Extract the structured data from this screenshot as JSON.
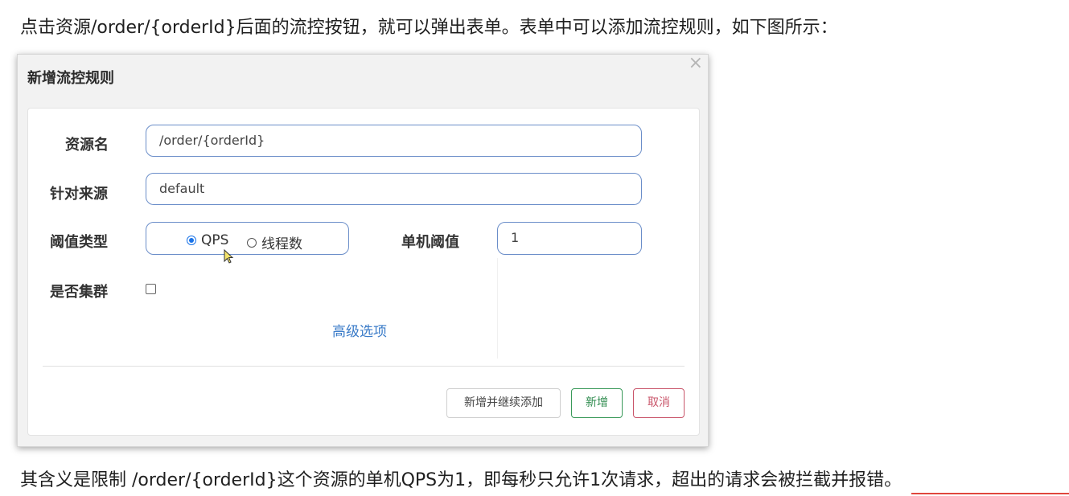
{
  "intro_text": "点击资源/order/{orderId}后面的流控按钮，就可以弹出表单。表单中可以添加流控规则，如下图所示：",
  "outro_text": "其含义是限制 /order/{orderId}这个资源的单机QPS为1，即每秒只允许1次请求，超出的请求会被拦截并报错。",
  "dialog": {
    "title": "新增流控规则",
    "close_icon": "close-icon",
    "fields": {
      "resource_label": "资源名",
      "resource_value": "/order/{orderId}",
      "source_label": "针对来源",
      "source_value": "default",
      "threshold_type_label": "阈值类型",
      "threshold_type_options": [
        "QPS",
        "线程数"
      ],
      "threshold_type_selected": "QPS",
      "single_threshold_label": "单机阈值",
      "single_threshold_value": "1",
      "cluster_label": "是否集群",
      "cluster_checked": false
    },
    "advanced_link": "高级选项",
    "buttons": {
      "add_continue": "新增并继续添加",
      "add": "新增",
      "cancel": "取消"
    }
  },
  "colors": {
    "field_border": "#6b8ec9",
    "radio_selected": "#1a73e8",
    "link": "#3a7bc8",
    "add_button": "#2e8b4e",
    "cancel_button": "#c9566b"
  }
}
